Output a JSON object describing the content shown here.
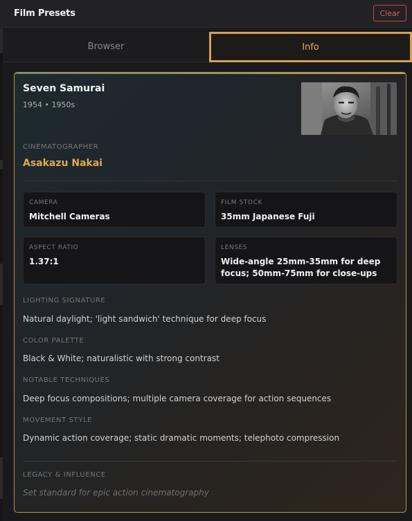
{
  "header": {
    "title": "Film Presets",
    "clear_label": "Clear"
  },
  "tabs": [
    {
      "label": "Browser",
      "active": false
    },
    {
      "label": "Info",
      "active": true
    }
  ],
  "film": {
    "title": "Seven Samurai",
    "meta": "1954 • 1950s",
    "cinematographer_label": "CINEMATOGRAPHER",
    "cinematographer": "Asakazu Nakai",
    "specs": {
      "camera_label": "CAMERA",
      "camera": "Mitchell Cameras",
      "film_stock_label": "FILM STOCK",
      "film_stock": "35mm Japanese Fuji",
      "aspect_ratio_label": "ASPECT RATIO",
      "aspect_ratio": "1.37:1",
      "lenses_label": "LENSES",
      "lenses": "Wide-angle 25mm-35mm for deep focus; 50mm-75mm for close-ups"
    },
    "lighting_label": "LIGHTING SIGNATURE",
    "lighting": "Natural daylight; 'light sandwich' technique for deep focus",
    "palette_label": "COLOR PALETTE",
    "palette": "Black & White; naturalistic with strong contrast",
    "techniques_label": "NOTABLE TECHNIQUES",
    "techniques": "Deep focus compositions; multiple camera coverage for action sequences",
    "movement_label": "MOVEMENT STYLE",
    "movement": "Dynamic action coverage; static dramatic moments; telephoto compression",
    "legacy_label": "LEGACY & INFLUENCE",
    "legacy": "Set standard for epic action cinematography"
  },
  "colors": {
    "accent": "#e0a94a",
    "clear_button": "#e05a5a",
    "card_border": "#b8934a"
  }
}
